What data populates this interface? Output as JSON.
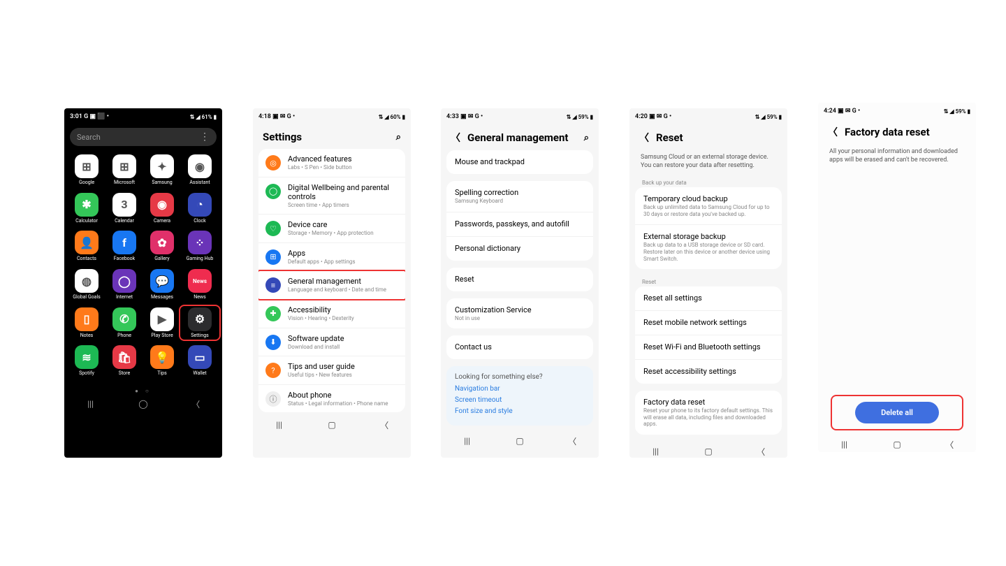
{
  "s1": {
    "time": "3:01",
    "statusL": "G ▣ ⬛ •",
    "statusR": "⇅ ◢ 61% ▮",
    "search": "Search",
    "apps": [
      [
        {
          "name": "Google",
          "cls": "c-white",
          "g": "⊞"
        },
        {
          "name": "Microsoft",
          "cls": "c-white",
          "g": "⊞"
        },
        {
          "name": "Samsung",
          "cls": "c-white",
          "g": "✦"
        },
        {
          "name": "Assistant",
          "cls": "c-white",
          "g": "◉"
        }
      ],
      [
        {
          "name": "Calculator",
          "cls": "c-green",
          "g": "✱"
        },
        {
          "name": "Calendar",
          "cls": "c-white",
          "g": "3"
        },
        {
          "name": "Camera",
          "cls": "c-red",
          "g": "◉"
        },
        {
          "name": "Clock",
          "cls": "c-navy",
          "g": "◔"
        }
      ],
      [
        {
          "name": "Contacts",
          "cls": "c-orange",
          "g": "👤"
        },
        {
          "name": "Facebook",
          "cls": "c-blue",
          "g": "f"
        },
        {
          "name": "Gallery",
          "cls": "c-pink",
          "g": "✿"
        },
        {
          "name": "Gaming Hub",
          "cls": "c-purple",
          "g": "⁘"
        }
      ],
      [
        {
          "name": "Global Goals",
          "cls": "c-white",
          "g": "◍"
        },
        {
          "name": "Internet",
          "cls": "c-purple",
          "g": "◯"
        },
        {
          "name": "Messages",
          "cls": "c-blue",
          "g": "💬"
        },
        {
          "name": "News",
          "cls": "c-news",
          "g": "News"
        }
      ],
      [
        {
          "name": "Notes",
          "cls": "c-orange",
          "g": "▯"
        },
        {
          "name": "Phone",
          "cls": "c-green",
          "g": "✆"
        },
        {
          "name": "Play Store",
          "cls": "c-white",
          "g": "▶"
        },
        {
          "name": "Settings",
          "cls": "c-dark",
          "g": "⚙"
        }
      ],
      [
        {
          "name": "Spotify",
          "cls": "c-dgreen",
          "g": "≋"
        },
        {
          "name": "Store",
          "cls": "c-red",
          "g": "🛍"
        },
        {
          "name": "Tips",
          "cls": "c-orange",
          "g": "💡"
        },
        {
          "name": "Wallet",
          "cls": "c-navy",
          "g": "▭"
        }
      ]
    ]
  },
  "s2": {
    "time": "4:18",
    "statusL": "▣ ✉ G •",
    "statusR": "⇅ ◢ 60% ▮",
    "title": "Settings",
    "rows": [
      {
        "ic": "c-orange",
        "g": "◎",
        "t": "Advanced features",
        "s": "Labs • S Pen • Side button"
      },
      {
        "ic": "c-dgreen",
        "g": "◯",
        "t": "Digital Wellbeing and parental controls",
        "s": "Screen time • App timers"
      },
      {
        "ic": "c-dgreen",
        "g": "♡",
        "t": "Device care",
        "s": "Storage • Memory • App protection"
      },
      {
        "ic": "c-blue",
        "g": "⊞",
        "t": "Apps",
        "s": "Default apps • App settings"
      },
      {
        "ic": "c-navy",
        "g": "≡",
        "t": "General management",
        "s": "Language and keyboard • Date and time",
        "hl": true
      },
      {
        "ic": "c-green",
        "g": "✚",
        "t": "Accessibility",
        "s": "Vision • Hearing • Dexterity"
      },
      {
        "ic": "c-blue",
        "g": "⬇",
        "t": "Software update",
        "s": "Download and install"
      },
      {
        "ic": "c-orange",
        "g": "?",
        "t": "Tips and user guide",
        "s": "Useful tips • New features"
      },
      {
        "ic": "",
        "g": "ⓘ",
        "t": "About phone",
        "s": "Status • Legal information • Phone name"
      }
    ]
  },
  "s3": {
    "time": "4:33",
    "statusL": "▣ ✉ G •",
    "statusR": "⇅ ◢ 59% ▮",
    "title": "General management",
    "rows": [
      {
        "t": "Mouse and trackpad"
      },
      {
        "t": "Spelling correction",
        "s": "Samsung Keyboard"
      },
      {
        "t": "Passwords, passkeys, and autofill"
      },
      {
        "t": "Personal dictionary"
      },
      {
        "t": "Reset",
        "hl": true
      },
      {
        "t": "Customization Service",
        "s": "Not in use",
        "link": true
      },
      {
        "t": "Contact us"
      }
    ],
    "look": {
      "title": "Looking for something else?",
      "links": [
        "Navigation bar",
        "Screen timeout",
        "Font size and style"
      ]
    }
  },
  "s4": {
    "time": "4:20",
    "statusL": "▣ ✉ G •",
    "statusR": "⇅ ◢ 59% ▮",
    "title": "Reset",
    "info": "Samsung Cloud or an external storage device. You can restore your data after resetting.",
    "sec1": "Back up your data",
    "r1": [
      {
        "t": "Temporary cloud backup",
        "s": "Back up unlimited data to Samsung Cloud for up to 30 days or restore data you've backed up."
      },
      {
        "t": "External storage backup",
        "s": "Back up data to a USB storage device or SD card. Restore later on this device or another device using Smart Switch."
      }
    ],
    "sec2": "Reset",
    "r2": [
      {
        "t": "Reset all settings"
      },
      {
        "t": "Reset mobile network settings"
      },
      {
        "t": "Reset Wi-Fi and Bluetooth settings"
      },
      {
        "t": "Reset accessibility settings"
      }
    ],
    "r3": [
      {
        "t": "Factory data reset",
        "s": "Reset your phone to its factory default settings. This will erase all data, including files and downloaded apps.",
        "hl": true
      }
    ]
  },
  "s5": {
    "time": "4:24",
    "statusL": "▣ ✉ G •",
    "statusR": "⇅ ◢ 59% ▮",
    "title": "Factory data reset",
    "info": "All your personal information and downloaded apps will be erased and can't be recovered.",
    "btn": "Delete all"
  }
}
